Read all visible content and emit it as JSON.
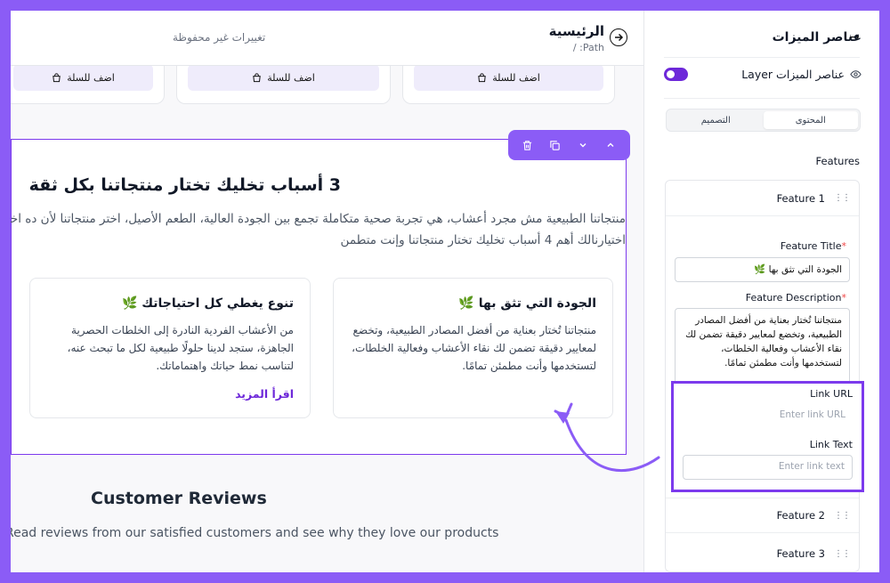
{
  "header": {
    "title": "الرئيسية",
    "path": "Path: /",
    "unsaved": "تغييرات غير محفوظة"
  },
  "products": {
    "cart_label": "اضف للسلة"
  },
  "section": {
    "title": "3 أسباب تخليك تختار منتجاتنا بكل ثقة",
    "description": "منتجاتنا الطبيعية مش مجرد أعشاب، هي تجربة صحية متكاملة تجمع بين الجودة العالية، الطعم الأصيل، اختر منتجاتنا لأن ده اختيارك، اختيارنالك أهم 4 أسباب تخليك تختار منتجاتنا وإنت متطمن",
    "features": [
      {
        "title": "الجودة التي تثق بها 🌿",
        "text": "منتجاتنا تُختار بعناية من أفضل المصادر الطبيعية، وتخضع لمعايير دقيقة تضمن لك نقاء الأعشاب وفعالية الخلطات، لتستخدمها وأنت مطمئن تمامًا."
      },
      {
        "title": "تنوع يغطي كل احتياجاتك 🌿",
        "text": "من الأعشاب الفردية النادرة إلى الخلطات الحصرية الجاهزة، ستجد لدينا حلولًا طبيعية لكل ما تبحث عنه، لتناسب نمط حياتك واهتماماتك.",
        "link": "اقرأ المزيد"
      }
    ]
  },
  "reviews": {
    "title": "Customer Reviews",
    "subtitle": "Read reviews from our satisfied customers and see why they love our products"
  },
  "sidebar": {
    "title": "عناصر الميزات",
    "layer_label": "عناصر الميزات Layer",
    "tabs": {
      "content": "المحتوى",
      "design": "التصميم"
    },
    "features_label": "Features",
    "items": [
      {
        "label": "Feature 1"
      },
      {
        "label": "Feature 2"
      },
      {
        "label": "Feature 3"
      }
    ],
    "fields": {
      "title_label": "Feature Title",
      "title_value": "الجودة التي تثق بها 🌿",
      "desc_label": "Feature Description",
      "desc_value": "منتجاتنا تُختار بعناية من أفضل المصادر الطبيعية، وتخضع لمعايير دقيقة تضمن لك نقاء الأعشاب وفعالية الخلطات، لتستخدمها وأنت مطمئن تمامًا.",
      "link_url_label": "Link URL",
      "link_url_placeholder": "Enter link URL",
      "link_text_label": "Link Text",
      "link_text_placeholder": "Enter link text"
    }
  },
  "colors": {
    "accent": "#8b5cf6",
    "accent_dark": "#6d28d9",
    "required": "#ef4444"
  }
}
